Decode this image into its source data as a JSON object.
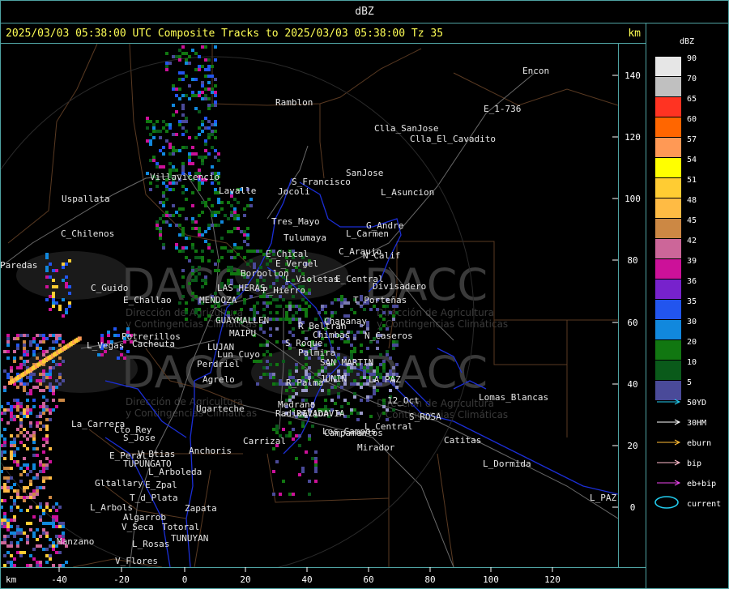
{
  "header": {
    "title": "dBZ"
  },
  "subtitle": "2025/03/03 05:38:00 UTC Composite Tracks to 2025/03/03 05:38:00 Tz 35",
  "km_label": "km",
  "axis_x": {
    "unit": "km",
    "ticks": [
      "-40",
      "-20",
      "0",
      "20",
      "40",
      "60",
      "80",
      "100",
      "120"
    ]
  },
  "axis_y": {
    "ticks": [
      "140",
      "120",
      "100",
      "80",
      "60",
      "40",
      "20",
      "0"
    ]
  },
  "watermark": {
    "brand": "DACC",
    "line1": "Dirección de Agricultura",
    "line2": "y Contingencias Climáticas"
  },
  "legend": {
    "title": "dBZ",
    "colors": [
      {
        "label": "90",
        "color": "#e6e6e6"
      },
      {
        "label": "70",
        "color": "#c0c0c0"
      },
      {
        "label": "65",
        "color": "#ff3322"
      },
      {
        "label": "60",
        "color": "#ff6600"
      },
      {
        "label": "57",
        "color": "#ff9955"
      },
      {
        "label": "54",
        "color": "#ffff00"
      },
      {
        "label": "51",
        "color": "#ffcc33"
      },
      {
        "label": "48",
        "color": "#ffbb44"
      },
      {
        "label": "45",
        "color": "#cc8844"
      },
      {
        "label": "42",
        "color": "#cc6699"
      },
      {
        "label": "39",
        "color": "#cc1199"
      },
      {
        "label": "36",
        "color": "#7722cc"
      },
      {
        "label": "35",
        "color": "#2255ee"
      },
      {
        "label": "30",
        "color": "#1188dd"
      },
      {
        "label": "20",
        "color": "#117711"
      },
      {
        "label": "10",
        "color": "#0a5a1a"
      },
      {
        "label": "5",
        "color": "#4a4a99"
      }
    ],
    "tracks": [
      {
        "label": "50YD",
        "color": "#22ccee"
      },
      {
        "label": "30HM",
        "color": "#ffffff"
      },
      {
        "label": "eburn",
        "color": "#ffbb33"
      },
      {
        "label": "bip",
        "color": "#ffbbcc"
      },
      {
        "label": "eb+bip",
        "color": "#ee44ee"
      },
      {
        "label": "current",
        "color": "#22ccee"
      }
    ]
  },
  "places": [
    {
      "name": "Encon"
    },
    {
      "name": "Ramblon"
    },
    {
      "name": "E_1-736"
    },
    {
      "name": "Clla_SanJose"
    },
    {
      "name": "Clla_El_Cavadito"
    },
    {
      "name": "S_Francisco"
    },
    {
      "name": "SanJose"
    },
    {
      "name": "Jocoli"
    },
    {
      "name": "L_Asuncion"
    },
    {
      "name": "Villavicencio"
    },
    {
      "name": "Uspallata"
    },
    {
      "name": "Lavalle"
    },
    {
      "name": "Tres_Mayo"
    },
    {
      "name": "G_Andre"
    },
    {
      "name": "Tulumaya"
    },
    {
      "name": "L_Carmen"
    },
    {
      "name": "C_Chilenos"
    },
    {
      "name": "E_Chical"
    },
    {
      "name": "C_Araujo"
    },
    {
      "name": "N_Calif"
    },
    {
      "name": "E_Vergel"
    },
    {
      "name": "Borbollon"
    },
    {
      "name": "L_Violetas"
    },
    {
      "name": "E_Central"
    },
    {
      "name": "Divisadero"
    },
    {
      "name": "Paredas"
    },
    {
      "name": "C_Guido"
    },
    {
      "name": "LAS HERAS"
    },
    {
      "name": "P_Hierro"
    },
    {
      "name": "E_Challao"
    },
    {
      "name": "MENDOZA"
    },
    {
      "name": "T_Porteñas"
    },
    {
      "name": "Chapanay"
    },
    {
      "name": "R_Beltran"
    },
    {
      "name": "Potrerillos"
    },
    {
      "name": "Cacheuta"
    },
    {
      "name": "GUAYMALLEN"
    },
    {
      "name": "MAIPU"
    },
    {
      "name": "Chimbas"
    },
    {
      "name": "N_Caseros"
    },
    {
      "name": "L_Vegas"
    },
    {
      "name": "S_Roque"
    },
    {
      "name": "Perdriel"
    },
    {
      "name": "LUJAN"
    },
    {
      "name": "Lun_Cuyo"
    },
    {
      "name": "Palmira"
    },
    {
      "name": "SAN MARTIN"
    },
    {
      "name": "Agrelo"
    },
    {
      "name": "R_Palma"
    },
    {
      "name": "JUNIN"
    },
    {
      "name": "LA PAZ"
    },
    {
      "name": "Lomas_Blancas"
    },
    {
      "name": "Ugarteche"
    },
    {
      "name": "Medrano"
    },
    {
      "name": "RIVADAVIA"
    },
    {
      "name": "Los_Campos"
    },
    {
      "name": "12_Oct"
    },
    {
      "name": "La_Carrera"
    },
    {
      "name": "Radicacion"
    },
    {
      "name": "L_Central"
    },
    {
      "name": "S_ROSA"
    },
    {
      "name": "Cto_Rey"
    },
    {
      "name": "Carrizal"
    },
    {
      "name": "Campamentos"
    },
    {
      "name": "S_Jose"
    },
    {
      "name": "Mirador"
    },
    {
      "name": "Catitas"
    },
    {
      "name": "Anchoris"
    },
    {
      "name": "E_Peral"
    },
    {
      "name": "V_Btias"
    },
    {
      "name": "TUPUNGATO"
    },
    {
      "name": "L_Dormida"
    },
    {
      "name": "L_Arboleda"
    },
    {
      "name": "Gltallary"
    },
    {
      "name": "E_Zpal"
    },
    {
      "name": "T_d_Plata"
    },
    {
      "name": "L_PAZ"
    },
    {
      "name": "L_Arbols"
    },
    {
      "name": "Zapata"
    },
    {
      "name": "Algarrob"
    },
    {
      "name": "V_Seca"
    },
    {
      "name": "Totoral"
    },
    {
      "name": "TUNUYAN"
    },
    {
      "name": "Manzano"
    },
    {
      "name": "L_Rosas"
    },
    {
      "name": "V_Flores"
    }
  ]
}
